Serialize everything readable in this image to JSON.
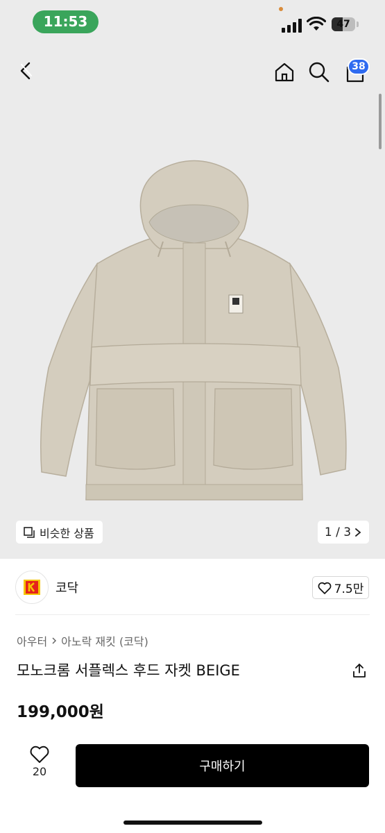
{
  "status_bar": {
    "time": "11:53",
    "battery_level": "47",
    "battery_fraction": 0.47
  },
  "nav": {
    "cart_badge": "38",
    "icons": [
      "back-icon",
      "home-icon",
      "search-icon",
      "cart-icon"
    ]
  },
  "gallery": {
    "similar_label": "비슷한 상품",
    "pager": "1 / 3"
  },
  "brand": {
    "name": "코닥",
    "like_count": "7.5만"
  },
  "product": {
    "breadcrumb": [
      "아우터",
      "아노락 재킷 (코닥)"
    ],
    "title": "모노크롬 서플렉스 후드 자켓 BEIGE",
    "price": "199,000원"
  },
  "bottom_bar": {
    "wish_count": "20",
    "buy_label": "구매하기"
  },
  "colors": {
    "time_pill": "#3aa55b",
    "badge": "#2f6bf0",
    "buy_button": "#000000",
    "jacket": "#d4cdbe",
    "brand_red": "#e5231b",
    "brand_yellow": "#f5c400"
  }
}
